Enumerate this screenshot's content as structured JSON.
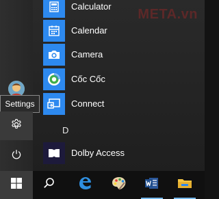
{
  "watermark": "META.vn",
  "tooltip": {
    "settings": "Settings"
  },
  "section": {
    "header": "D"
  },
  "apps": {
    "calculator": "Calculator",
    "calendar": "Calendar",
    "camera": "Camera",
    "coccoc": "Cốc Cốc",
    "connect": "Connect",
    "dolby": "Dolby Access"
  },
  "icons": {
    "settings": "gear-icon",
    "power": "power-icon",
    "start": "windows-logo-icon",
    "search": "search-icon",
    "edge": "edge-icon",
    "paint": "paint-icon",
    "word": "word-icon",
    "explorer": "folder-icon"
  },
  "colors": {
    "tile_blue": "#2d89ef",
    "dolby_tile": "#1d1a3b",
    "taskbar": "#101010",
    "accent": "#76b9ed"
  }
}
